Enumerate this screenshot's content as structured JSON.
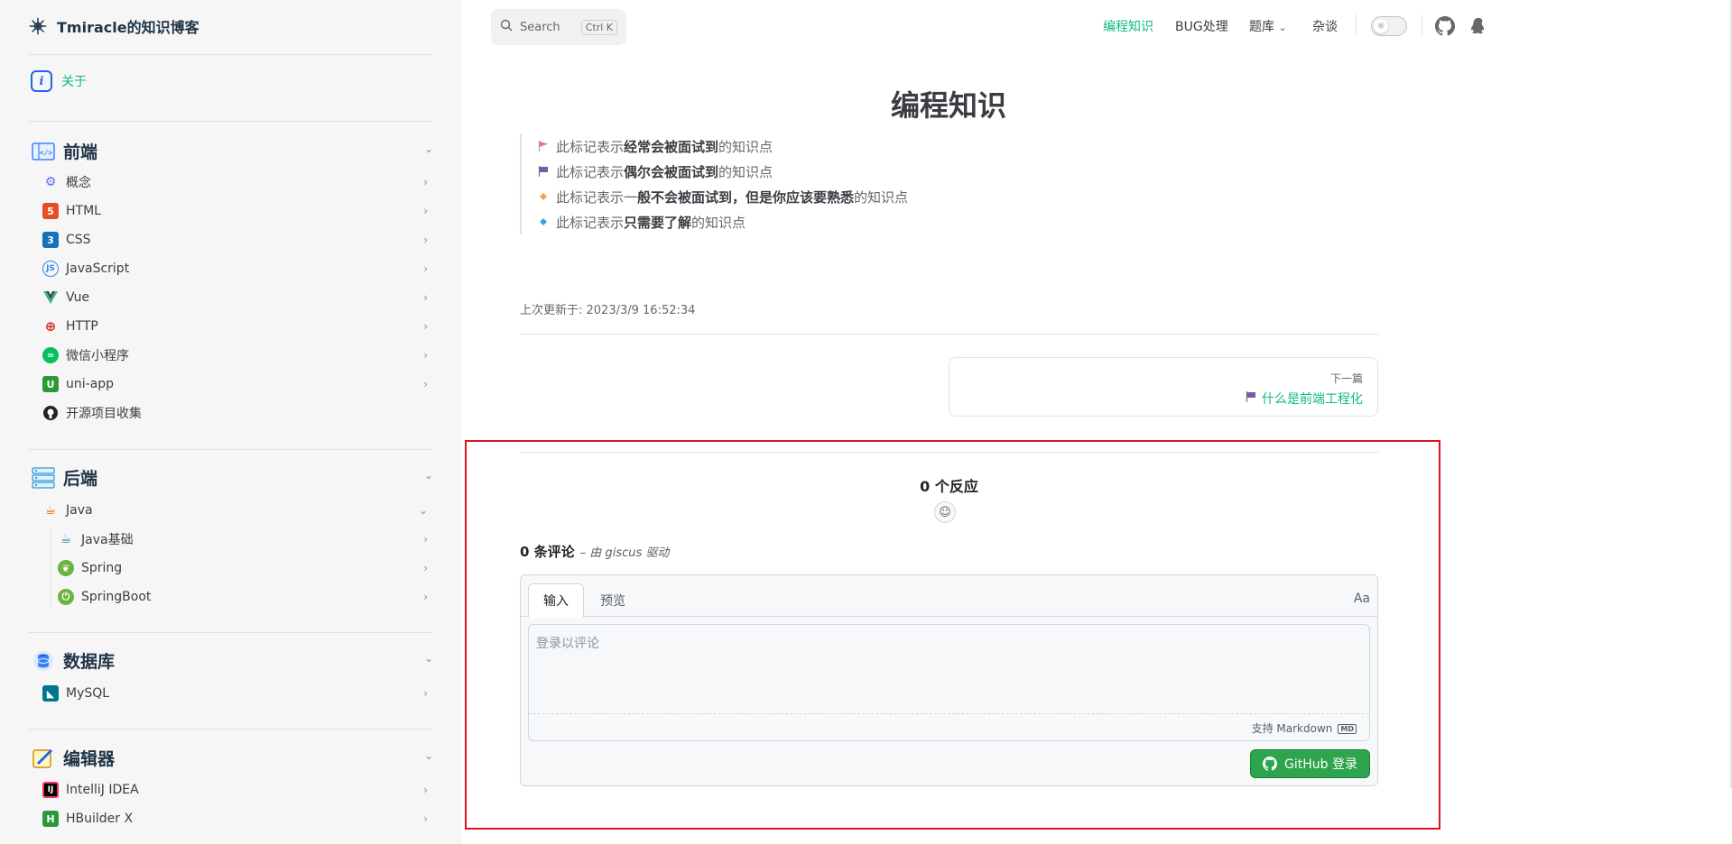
{
  "brand": {
    "title": "Tmiracle的知识博客"
  },
  "sidebar": {
    "about": "关于",
    "groups": [
      {
        "title": "前端",
        "items": [
          "概念",
          "HTML",
          "CSS",
          "JavaScript",
          "Vue",
          "HTTP",
          "微信小程序",
          "uni-app",
          "开源项目收集"
        ]
      },
      {
        "title": "后端",
        "items": [
          "Java"
        ],
        "subitems": [
          "Java基础",
          "Spring",
          "SpringBoot"
        ]
      },
      {
        "title": "数据库",
        "items": [
          "MySQL"
        ]
      },
      {
        "title": "编辑器",
        "items": [
          "IntelliJ IDEA",
          "HBuilder X"
        ]
      }
    ]
  },
  "topnav": {
    "search_label": "Search",
    "search_kbd": "Ctrl K",
    "links": [
      "编程知识",
      "BUG处理",
      "题库",
      "杂谈"
    ]
  },
  "page": {
    "title": "编程知识",
    "legend": [
      {
        "pre": "此标记表示",
        "bold": "经常会被面试到",
        "post": "的知识点"
      },
      {
        "pre": "此标记表示",
        "bold": "偶尔会被面试到",
        "post": "的知识点"
      },
      {
        "pre": "此标记表示一",
        "bold": "般不会被面试到，但是你应该要熟悉",
        "post": "的知识点"
      },
      {
        "pre": "此标记表示",
        "bold": "只需要了解",
        "post": "的知识点"
      }
    ],
    "last_updated": "上次更新于: 2023/3/9 16:52:34",
    "next_label": "下一篇",
    "next_link": "什么是前端工程化"
  },
  "comments": {
    "reactions": "0 个反应",
    "count": "0 条评论",
    "powered": "– 由 giscus 驱动",
    "tab_input": "输入",
    "tab_preview": "预览",
    "aa": "Aa",
    "placeholder": "登录以评论",
    "markdown": "支持 Markdown",
    "md_icon": "MD",
    "login_button": "GitHub 登录"
  },
  "colors": {
    "accent": "#10b981",
    "highlight": "#e0131b",
    "github_green": "#2da44e"
  }
}
